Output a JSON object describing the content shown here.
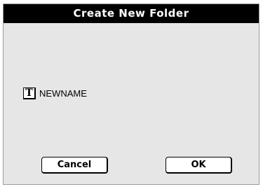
{
  "dialog": {
    "title": "Create New Folder",
    "text_edit_button_label": "T",
    "folder_name": "NEWNAME",
    "cancel_label": "Cancel",
    "ok_label": "OK"
  },
  "icons": {
    "text_edit": "text-edit-icon"
  },
  "colors": {
    "titlebar_bg": "#000000",
    "titlebar_fg": "#ffffff",
    "dialog_bg": "#e6e6e6",
    "button_bg": "#ffffff"
  }
}
